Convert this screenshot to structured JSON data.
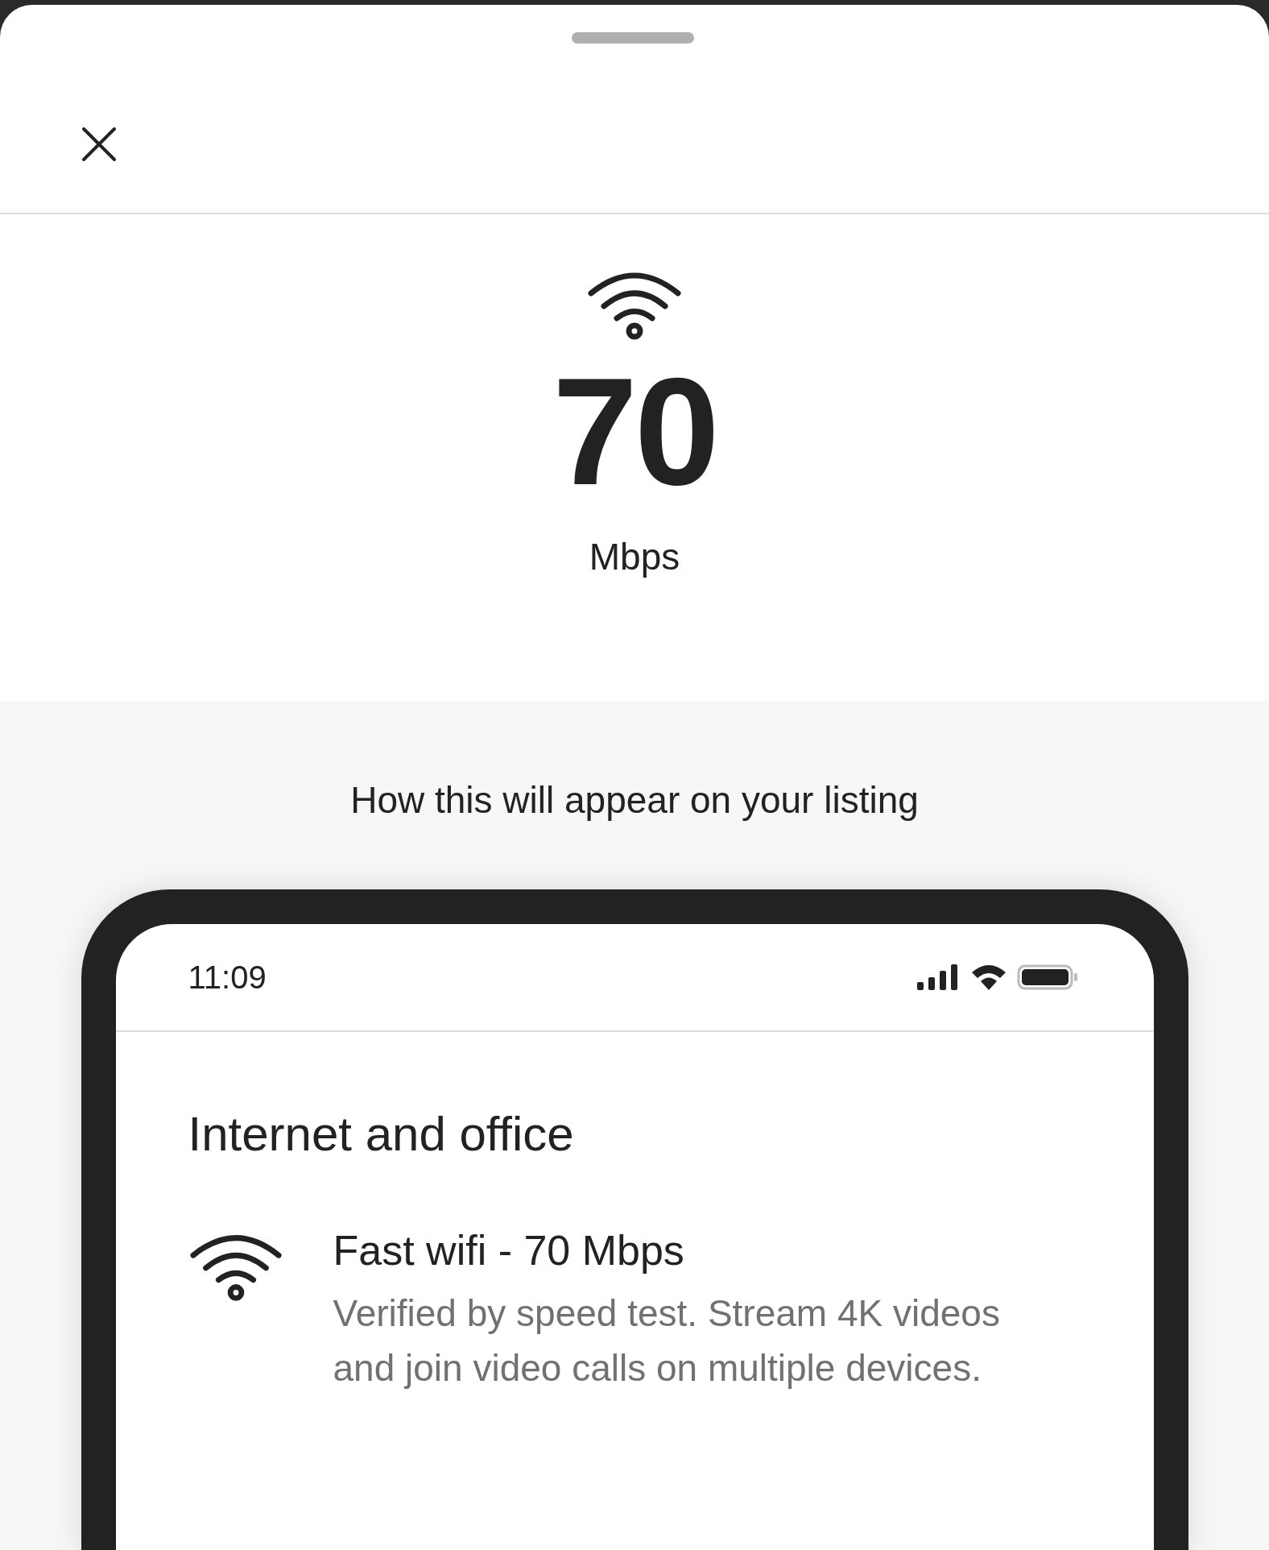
{
  "speed": {
    "value": "70",
    "unit": "Mbps"
  },
  "preview": {
    "heading": "How this will appear on your listing",
    "phone": {
      "time": "11:09",
      "section_title": "Internet and office",
      "amenity": {
        "title": "Fast wifi - 70 Mbps",
        "description": "Verified by speed test. Stream 4K videos and join video calls on multiple devices."
      }
    }
  }
}
